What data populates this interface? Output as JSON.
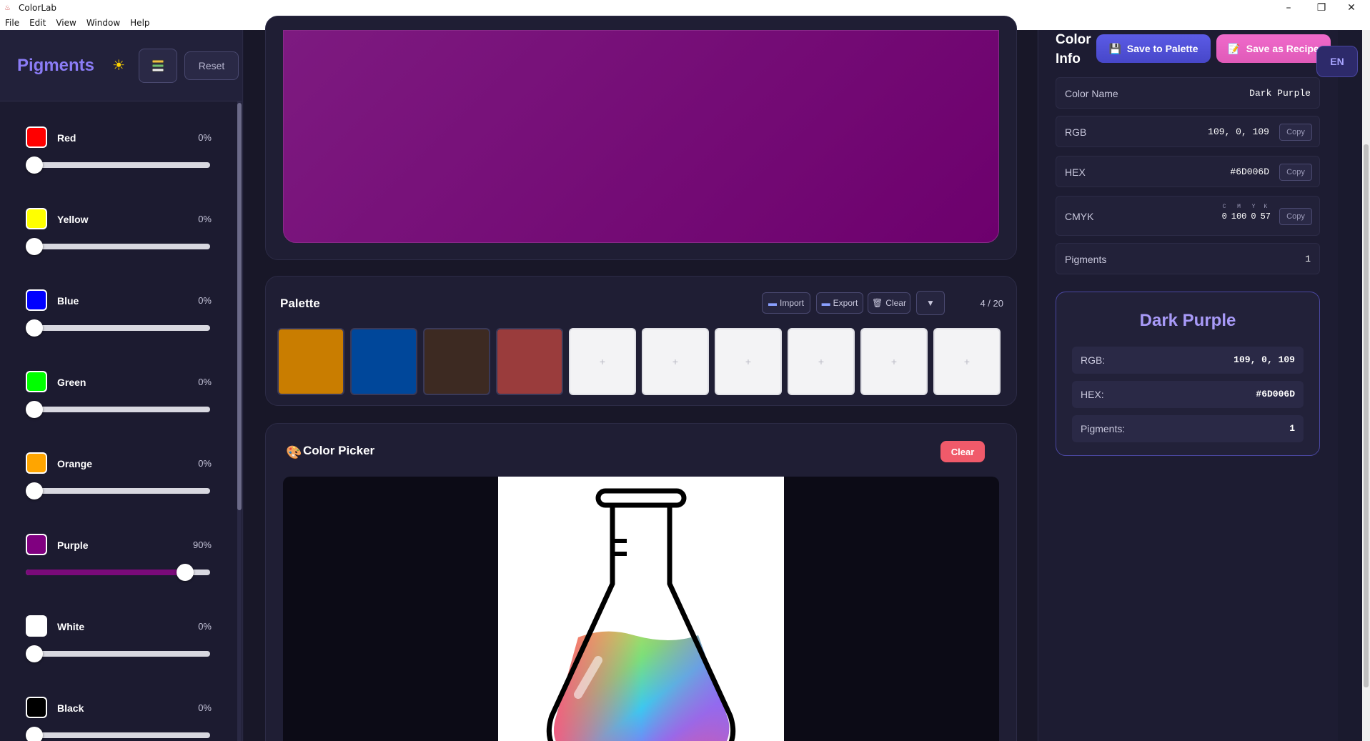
{
  "window": {
    "title": "ColorLab",
    "minimize": "–",
    "restore": "❐",
    "close": "✕"
  },
  "menu": [
    "File",
    "Edit",
    "View",
    "Window",
    "Help"
  ],
  "pigments_panel": {
    "title": "Pigments",
    "theme_icon": "sun-icon",
    "stack_icon": "layers-icon",
    "reset_label": "Reset",
    "pigments": [
      {
        "name": "Red",
        "percent_label": "0%",
        "value": 0,
        "color": "#ff0000"
      },
      {
        "name": "Yellow",
        "percent_label": "0%",
        "value": 0,
        "color": "#ffff00"
      },
      {
        "name": "Blue",
        "percent_label": "0%",
        "value": 0,
        "color": "#0000ff"
      },
      {
        "name": "Green",
        "percent_label": "0%",
        "value": 0,
        "color": "#00ff00"
      },
      {
        "name": "Orange",
        "percent_label": "0%",
        "value": 0,
        "color": "#ffa500"
      },
      {
        "name": "Purple",
        "percent_label": "90%",
        "value": 90,
        "color": "#800080"
      },
      {
        "name": "White",
        "percent_label": "0%",
        "value": 0,
        "color": "#ffffff"
      },
      {
        "name": "Black",
        "percent_label": "0%",
        "value": 0,
        "color": "#000000"
      }
    ]
  },
  "preview": {
    "color": "#6D006D"
  },
  "palette": {
    "title": "Palette",
    "import_label": "Import",
    "export_label": "Export",
    "clear_label": "Clear",
    "toggle_icon": "triangle-down-icon",
    "count": "4 / 20",
    "colors": [
      "#c97d00",
      "#00479a",
      "#3d2a22",
      "#9a3c3c"
    ],
    "empty_slots": 6,
    "empty_label": "+"
  },
  "picker": {
    "title": "Color Picker",
    "icon": "palette-icon",
    "clear_label": "Clear"
  },
  "info": {
    "title": "Color Info",
    "save_palette_label": "Save to Palette",
    "save_recipe_label": "Save as Recipe",
    "language": "EN",
    "rows": {
      "color_name_label": "Color Name",
      "color_name": "Dark Purple",
      "rgb_label": "RGB",
      "rgb": "109, 0, 109",
      "hex_label": "HEX",
      "hex": "#6D006D",
      "cmyk_label": "CMYK",
      "cmyk": {
        "c": "0",
        "m": "100",
        "y": "0",
        "k": "57"
      },
      "cmyk_letters": {
        "c": "C",
        "m": "M",
        "y": "Y",
        "k": "K"
      },
      "pigments_label": "Pigments",
      "pigments": "1",
      "copy_label": "Copy"
    },
    "summary": {
      "name": "Dark Purple",
      "rgb_label": "RGB:",
      "rgb": "109, 0, 109",
      "hex_label": "HEX:",
      "hex": "#6D006D",
      "pigments_label": "Pigments:",
      "pigments": "1"
    }
  }
}
